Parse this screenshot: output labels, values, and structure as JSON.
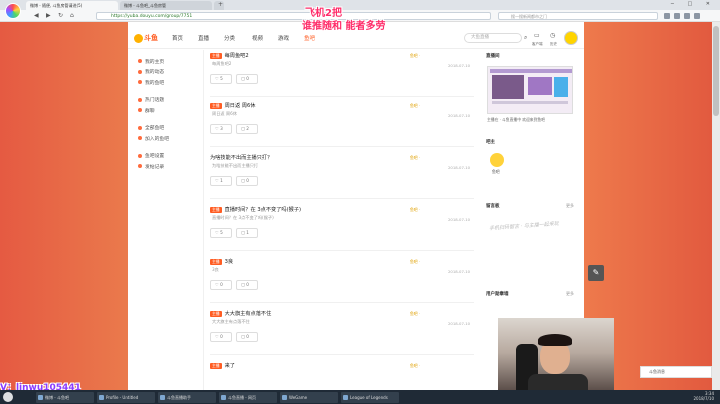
{
  "browser": {
    "tabs": [
      "微博 - 随便, 斗鱼房管请进(5)",
      "微博 - 斗鱼吧_斗鱼房管"
    ],
    "url": "https://yuba.douyu.com/group/7751",
    "search_placeholder": "搜一搜新闻都市之门"
  },
  "site": {
    "brand": "斗鱼",
    "nav": [
      "首页",
      "直播",
      "分类",
      "视频",
      "游戏",
      "鱼吧"
    ],
    "search_placeholder": "大鱼直播",
    "header_links": [
      "客户端",
      "历史"
    ]
  },
  "sidebar": {
    "items": [
      "我的主页",
      "我的动态",
      "我的鱼吧",
      "热门话题",
      "群聊",
      "全部鱼吧",
      "加入的鱼吧",
      "鱼吧设置",
      "发帖记录"
    ]
  },
  "posts": [
    {
      "tag": "主播",
      "title": "每周鱼吧2",
      "sub": "每周鱼吧2",
      "up": "5",
      "down": "0",
      "meta1": "鱼吧 ·",
      "meta2": "2018-07-10"
    },
    {
      "tag": "主播",
      "title": "周日返 周6休",
      "sub": "周日返 周6休",
      "up": "3",
      "down": "2",
      "meta1": "鱼吧 ·",
      "meta2": "2018-07-10"
    },
    {
      "tag": "",
      "title": "为啥技能不出而主播只打？",
      "sub": "为啥技能不出而主播只打",
      "up": "1",
      "down": "0",
      "meta1": "鱼吧 ·",
      "meta2": "2018-07-10"
    },
    {
      "tag": "主播",
      "title": "直播时间？在 3点不变了吗(猴子)",
      "sub": "直播时间？在 3点不变了吗(猴子)",
      "up": "5",
      "down": "1",
      "meta1": "鱼吧 ·",
      "meta2": "2018-07-10"
    },
    {
      "tag": "主播",
      "title": "3良",
      "sub": "3良",
      "up": "0",
      "down": "0",
      "meta1": "鱼吧 ·",
      "meta2": "2018-07-10"
    },
    {
      "tag": "主播",
      "title": "大大旗主有点落不住",
      "sub": "大大旗主有点落不住",
      "up": "0",
      "down": "0",
      "meta1": "鱼吧 ·",
      "meta2": "2018-07-10"
    },
    {
      "tag": "主播",
      "title": "来了",
      "sub": "",
      "up": "",
      "down": "",
      "meta1": "鱼吧 ·",
      "meta2": "2018-07-10"
    }
  ],
  "right": {
    "card1_title": "直播间",
    "card1_caption": "主播在 · 斗鱼直播中 欢迎来到鱼吧",
    "card2_title": "吧主",
    "card2_name": "鱼吧",
    "card3_title": "留言板",
    "card3_more": "更多",
    "card3_text": "手机扫码留言 · 与主播一起来玩",
    "card4_title": "用户勋章墙",
    "card4_more": "更多"
  },
  "overlay": {
    "line1": "飞机2把",
    "line2": "谁推随和 能者多劳",
    "id_text": "V：linwu105441"
  },
  "notification": "斗鱼消息",
  "taskbar": [
    "微博 - 斗鱼吧",
    "Profile - Untitled",
    "斗鱼直播助手",
    "斗鱼直播 - 网页",
    "WeGame",
    "League of Legends"
  ],
  "tray": {
    "time": "3:34",
    "date": "2018/7/10"
  }
}
